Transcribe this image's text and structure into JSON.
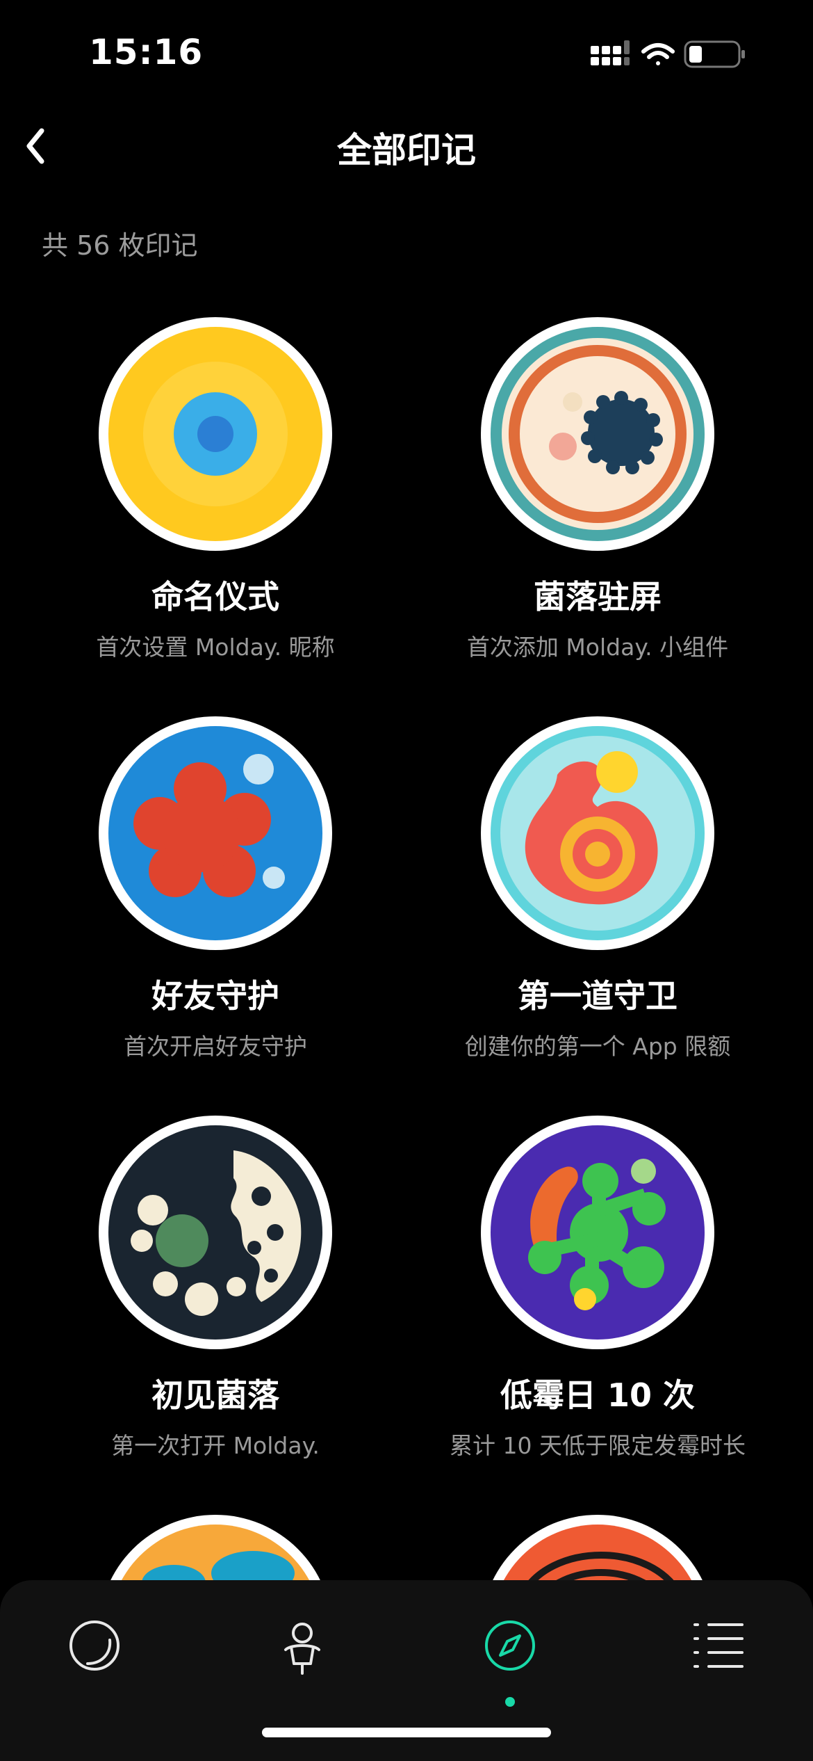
{
  "status_bar": {
    "time": "15:16"
  },
  "nav": {
    "title": "全部印记"
  },
  "summary": {
    "count_text": "共 56 枚印记"
  },
  "badges": [
    {
      "title": "命名仪式",
      "desc": "首次设置 Molday. 昵称"
    },
    {
      "title": "菌落驻屏",
      "desc": "首次添加 Molday. 小组件"
    },
    {
      "title": "好友守护",
      "desc": "首次开启好友守护"
    },
    {
      "title": "第一道守卫",
      "desc": "创建你的第一个 App 限额"
    },
    {
      "title": "初见菌落",
      "desc": "第一次打开 Molday."
    },
    {
      "title": "低霉日 10 次",
      "desc": "累计 10 天低于限定发霉时长"
    }
  ],
  "tab_bar": {
    "tabs": [
      {
        "icon": "moon-circle-icon",
        "active": false
      },
      {
        "icon": "person-icon",
        "active": false
      },
      {
        "icon": "compass-icon",
        "active": true
      },
      {
        "icon": "list-icon",
        "active": false
      }
    ],
    "active_color": "#19D9A8"
  }
}
